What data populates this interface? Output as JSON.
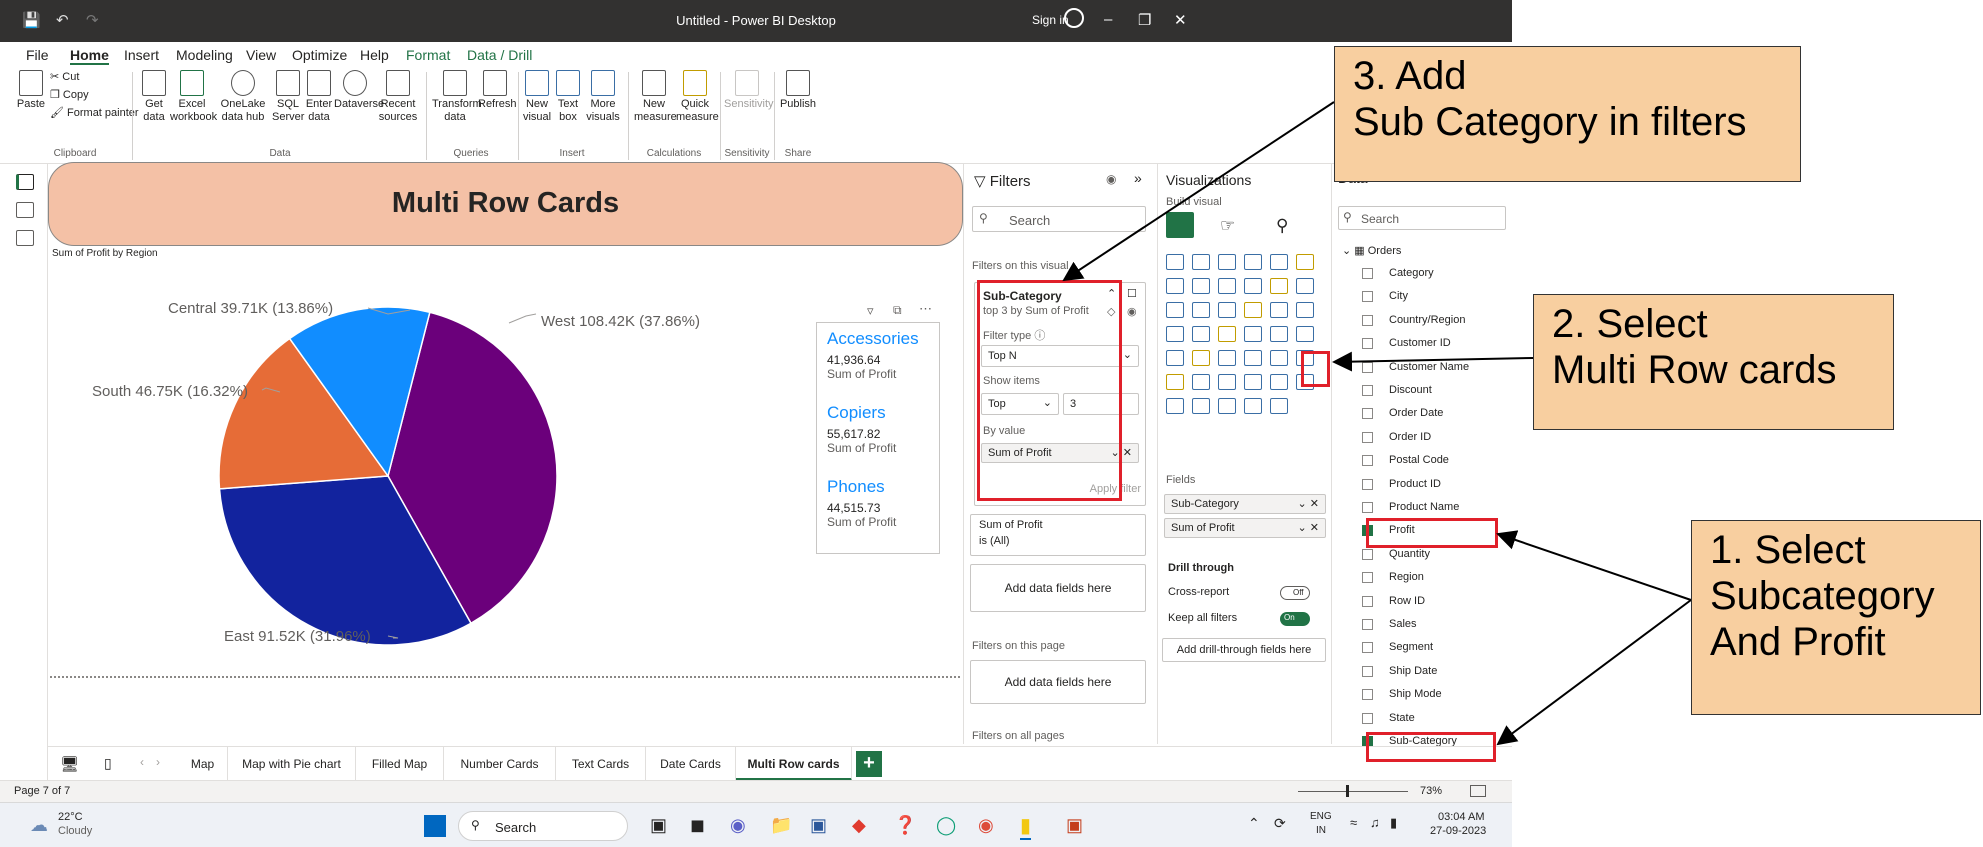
{
  "window": {
    "title": "Untitled - Power BI Desktop",
    "sign_in": "Sign in"
  },
  "menu": [
    "File",
    "Home",
    "Insert",
    "Modeling",
    "View",
    "Optimize",
    "Help",
    "Format",
    "Data / Drill"
  ],
  "ribbon": {
    "clipboard": {
      "paste": "Paste",
      "cut": "Cut",
      "copy": "Copy",
      "format_painter": "Format painter",
      "group": "Clipboard"
    },
    "data": {
      "get_data": "Get data",
      "excel": "Excel workbook",
      "onelake": "OneLake data hub",
      "sql": "SQL Server",
      "enter": "Enter data",
      "dataverse": "Dataverse",
      "recent": "Recent sources",
      "group": "Data"
    },
    "queries": {
      "transform": "Transform data",
      "refresh": "Refresh",
      "group": "Queries"
    },
    "insert": {
      "new_visual": "New visual",
      "text_box": "Text box",
      "more_visuals": "More visuals",
      "group": "Insert"
    },
    "calculations": {
      "new_measure": "New measure",
      "quick_measure": "Quick measure",
      "group": "Calculations"
    },
    "sensitivity": {
      "label": "Sensitivity",
      "group": "Sensitivity"
    },
    "share": {
      "publish": "Publish",
      "group": "Share"
    }
  },
  "banner": {
    "title": "Multi Row Cards"
  },
  "pie": {
    "title": "Sum of Profit by Region",
    "labels": [
      "Central 39.71K (13.86%)",
      "West 108.42K (37.86%)",
      "South 46.75K (16.32%)",
      "East 91.52K (31.96%)"
    ]
  },
  "chart_data": {
    "type": "pie",
    "title": "Sum of Profit by Region",
    "categories": [
      "West",
      "East",
      "South",
      "Central"
    ],
    "values": [
      108.42,
      91.52,
      46.75,
      39.71
    ],
    "percents": [
      37.86,
      31.96,
      16.32,
      13.86
    ],
    "colors": [
      "#6b007b",
      "#12239e",
      "#e66c37",
      "#118dff"
    ]
  },
  "multirow": [
    {
      "name": "Accessories",
      "value": "41,936.64",
      "measure": "Sum of Profit"
    },
    {
      "name": "Copiers",
      "value": "55,617.82",
      "measure": "Sum of Profit"
    },
    {
      "name": "Phones",
      "value": "44,515.73",
      "measure": "Sum of Profit"
    }
  ],
  "filters": {
    "title": "Filters",
    "search": "Search",
    "on_visual": "Filters on this visual",
    "card_title": "Sub-Category",
    "card_sub": "top 3 by Sum of Profit",
    "filter_type_label": "Filter type",
    "filter_type": "Top N",
    "show_items": "Show items",
    "top": "Top",
    "count": "3",
    "by_value": "By value",
    "by_value_field": "Sum of Profit",
    "apply": "Apply filter",
    "sop_title": "Sum of Profit",
    "sop_sub": "is (All)",
    "add1": "Add data fields here",
    "on_page": "Filters on this page",
    "add2": "Add data fields here",
    "on_all": "Filters on all pages"
  },
  "viz": {
    "title": "Visualizations",
    "build": "Build visual",
    "fields_label": "Fields",
    "wells": [
      "Sub-Category",
      "Sum of Profit"
    ],
    "drill": "Drill through",
    "cross_report": "Cross-report",
    "cross_state": "Off",
    "keep_all": "Keep all filters",
    "keep_state": "On",
    "add_drill": "Add drill-through fields here"
  },
  "data_pane": {
    "title": "Data",
    "search": "Search",
    "table": "Orders",
    "fields": [
      {
        "name": "Category",
        "checked": false
      },
      {
        "name": "City",
        "checked": false
      },
      {
        "name": "Country/Region",
        "checked": false
      },
      {
        "name": "Customer ID",
        "checked": false
      },
      {
        "name": "Customer Name",
        "checked": false
      },
      {
        "name": "Discount",
        "checked": false
      },
      {
        "name": "Order Date",
        "checked": false
      },
      {
        "name": "Order ID",
        "checked": false
      },
      {
        "name": "Postal Code",
        "checked": false
      },
      {
        "name": "Product ID",
        "checked": false
      },
      {
        "name": "Product Name",
        "checked": false
      },
      {
        "name": "Profit",
        "checked": true
      },
      {
        "name": "Quantity",
        "checked": false
      },
      {
        "name": "Region",
        "checked": false
      },
      {
        "name": "Row ID",
        "checked": false
      },
      {
        "name": "Sales",
        "checked": false
      },
      {
        "name": "Segment",
        "checked": false
      },
      {
        "name": "Ship Date",
        "checked": false
      },
      {
        "name": "Ship Mode",
        "checked": false
      },
      {
        "name": "State",
        "checked": false
      },
      {
        "name": "Sub-Category",
        "checked": true
      }
    ]
  },
  "tabs": [
    "Map",
    "Map with Pie chart",
    "Filled Map",
    "Number Cards",
    "Text Cards",
    "Date Cards",
    "Multi Row cards"
  ],
  "status": {
    "page": "Page 7 of 7",
    "zoom": "73%"
  },
  "taskbar": {
    "temp": "22°C",
    "weather": "Cloudy",
    "search": "Search",
    "lang1": "ENG",
    "lang2": "IN",
    "time": "03:04 AM",
    "date": "27-09-2023"
  },
  "callouts": {
    "c3": [
      "3. Add",
      "Sub Category in filters"
    ],
    "c2": [
      "2. Select",
      "Multi Row cards"
    ],
    "c1": [
      "1. Select",
      "Subcategory",
      "And Profit"
    ]
  }
}
